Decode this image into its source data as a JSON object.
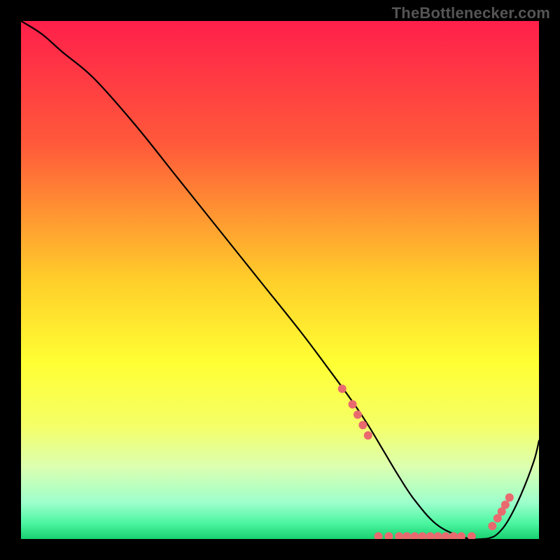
{
  "attribution": "TheBottlenecker.com",
  "chart_data": {
    "type": "line",
    "title": "",
    "xlabel": "",
    "ylabel": "",
    "xlim": [
      0,
      100
    ],
    "ylim": [
      0,
      100
    ],
    "gradient_stops": [
      {
        "offset": 0,
        "color": "#ff1f4b"
      },
      {
        "offset": 0.24,
        "color": "#ff5a3a"
      },
      {
        "offset": 0.5,
        "color": "#ffce2a"
      },
      {
        "offset": 0.66,
        "color": "#ffff33"
      },
      {
        "offset": 0.78,
        "color": "#f5ff66"
      },
      {
        "offset": 0.86,
        "color": "#dcffb0"
      },
      {
        "offset": 0.93,
        "color": "#9dffcc"
      },
      {
        "offset": 0.97,
        "color": "#4bf5a0"
      },
      {
        "offset": 1.0,
        "color": "#18d06e"
      }
    ],
    "series": [
      {
        "name": "bottleneck-curve",
        "x": [
          0,
          4,
          8,
          14,
          22,
          30,
          38,
          46,
          54,
          60,
          64,
          67,
          70,
          73,
          76,
          80,
          84,
          87,
          89,
          90.5,
          92,
          94,
          96.5,
          99,
          100
        ],
        "y": [
          100,
          97.5,
          94,
          89,
          80,
          70,
          60,
          50,
          40,
          32,
          26.5,
          22,
          17,
          12,
          7.5,
          3,
          0.8,
          0,
          0,
          0.2,
          1,
          3.5,
          8.5,
          15,
          19
        ]
      }
    ],
    "markers": {
      "name": "bottleneck-band-dots",
      "points": [
        {
          "x": 62,
          "y": 29
        },
        {
          "x": 64,
          "y": 26
        },
        {
          "x": 65,
          "y": 24
        },
        {
          "x": 66,
          "y": 22
        },
        {
          "x": 67,
          "y": 20
        },
        {
          "x": 69,
          "y": 0.5
        },
        {
          "x": 71,
          "y": 0.5
        },
        {
          "x": 73,
          "y": 0.5
        },
        {
          "x": 74.5,
          "y": 0.5
        },
        {
          "x": 76,
          "y": 0.5
        },
        {
          "x": 77.5,
          "y": 0.5
        },
        {
          "x": 79,
          "y": 0.5
        },
        {
          "x": 80.5,
          "y": 0.5
        },
        {
          "x": 82,
          "y": 0.5
        },
        {
          "x": 83.5,
          "y": 0.5
        },
        {
          "x": 85,
          "y": 0.5
        },
        {
          "x": 87,
          "y": 0.5
        },
        {
          "x": 91,
          "y": 2.5
        },
        {
          "x": 92,
          "y": 4
        },
        {
          "x": 92.8,
          "y": 5.3
        },
        {
          "x": 93.5,
          "y": 6.6
        },
        {
          "x": 94.3,
          "y": 8
        }
      ]
    }
  }
}
